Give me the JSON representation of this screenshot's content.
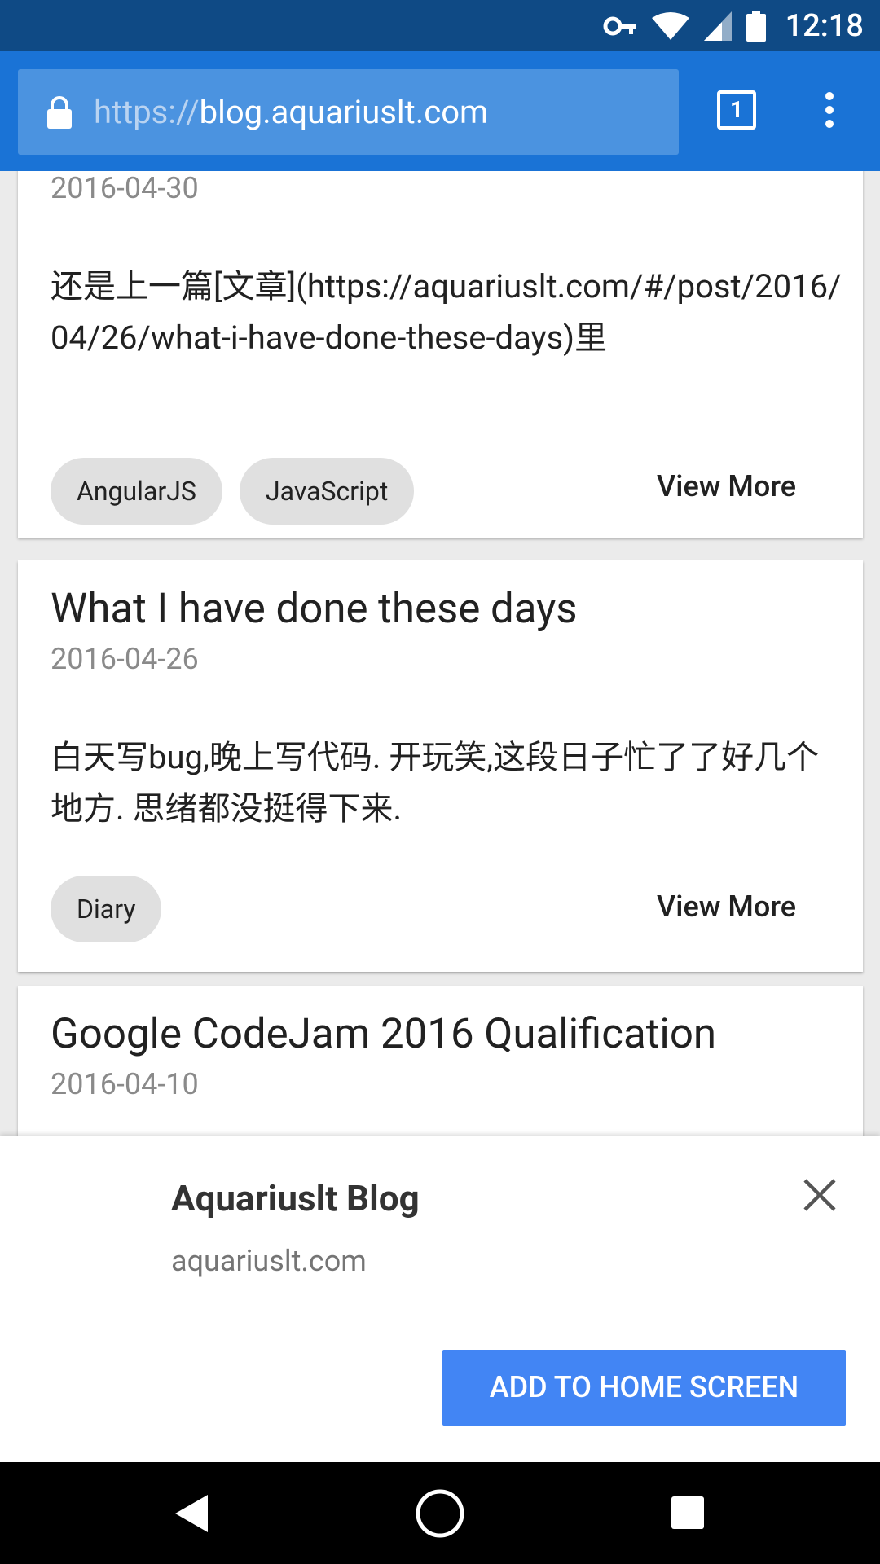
{
  "status_bar": {
    "time": "12:18",
    "icons": [
      "key-icon",
      "wifi-icon",
      "signal-icon",
      "battery-icon"
    ]
  },
  "browser": {
    "url_scheme": "https://",
    "url_host": "blog.aquariuslt.com",
    "tab_count": "1",
    "icons": [
      "lock-icon",
      "tabs-icon",
      "menu-icon"
    ]
  },
  "posts": [
    {
      "title": "",
      "date": "2016-04-30",
      "excerpt": "还是上一篇[文章](https://aquariuslt.com/#/post/2016/04/26/what-i-have-done-these-days)里",
      "tags": [
        "AngularJS",
        "JavaScript"
      ],
      "action": "View More"
    },
    {
      "title": "What I have done these days",
      "date": "2016-04-26",
      "excerpt": "白天写bug,晚上写代码. 开玩笑,这段日子忙了了好几个地方. 思绪都没挺得下来.",
      "tags": [
        "Diary"
      ],
      "action": "View More"
    },
    {
      "title": "Google CodeJam 2016 Qualification",
      "date": "2016-04-10"
    }
  ],
  "install_sheet": {
    "title": "Aquariuslt Blog",
    "domain": "aquariuslt.com",
    "button_label": "ADD TO HOME SCREEN",
    "accent_color": "#4285f4"
  },
  "nav_bar": {
    "icons": [
      "back-icon",
      "home-icon",
      "recents-icon"
    ]
  },
  "colors": {
    "status_bar": "#0f4a85",
    "toolbar": "#1a73d6",
    "omnibox": "#4b93e0"
  }
}
